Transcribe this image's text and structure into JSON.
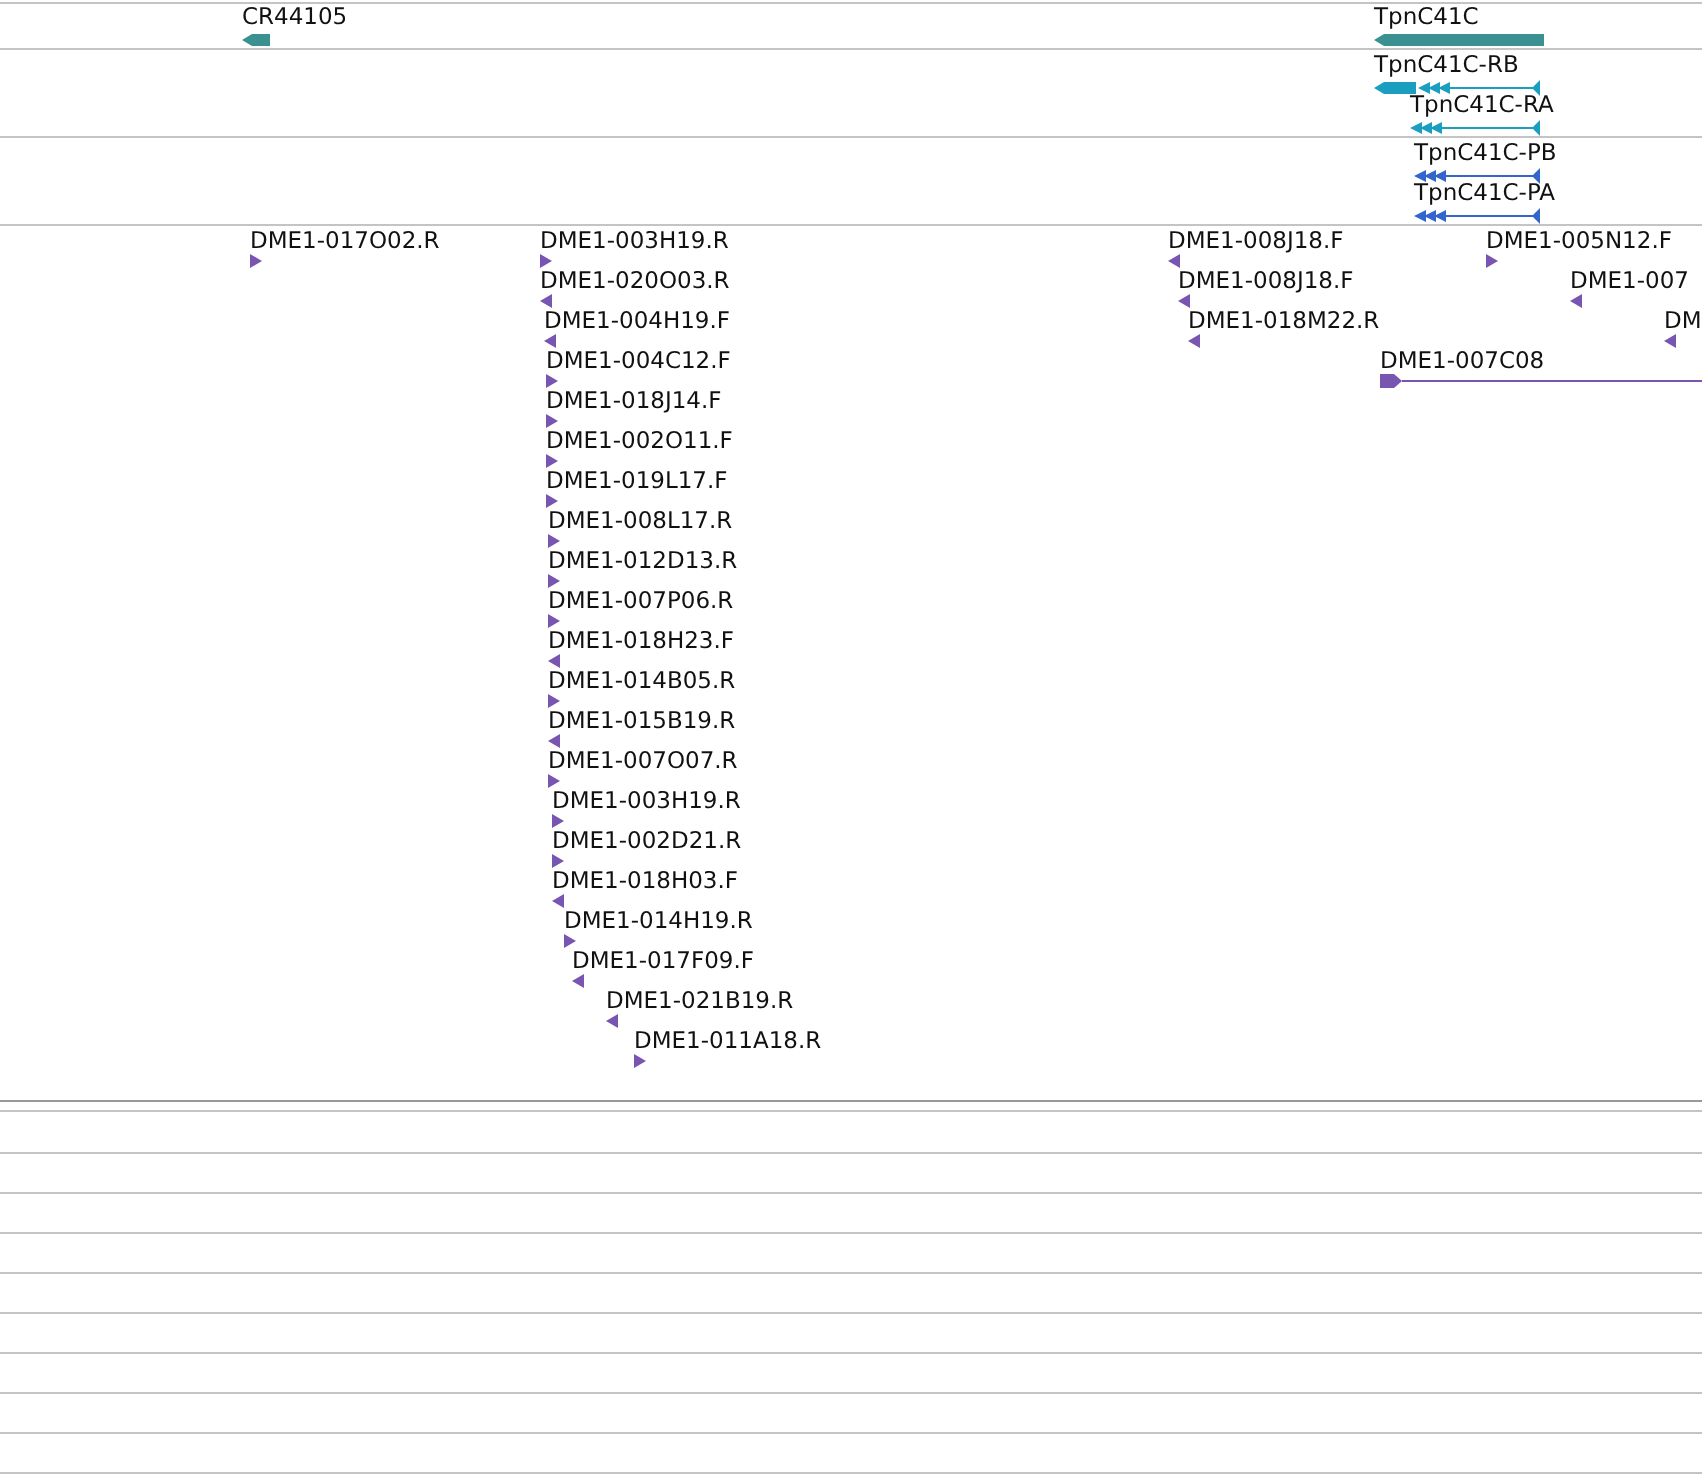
{
  "tracks": [
    {
      "color": "#3b9191",
      "features": [
        {
          "label": "CR44105",
          "kind": "gene",
          "reverse": true
        },
        {
          "label": "TpnC41C",
          "kind": "gene",
          "reverse": true
        }
      ]
    },
    {
      "color": "#1a9fc0",
      "features": [
        {
          "label": "TpnC41C-RB",
          "kind": "transcript",
          "reverse": true
        },
        {
          "label": "TpnC41C-RA",
          "kind": "transcript",
          "reverse": true
        }
      ]
    },
    {
      "color": "#3366cc",
      "features": [
        {
          "label": "TpnC41C-PB",
          "kind": "transcript",
          "reverse": true
        },
        {
          "label": "TpnC41C-PA",
          "kind": "transcript",
          "reverse": true
        }
      ]
    },
    {
      "color": "#7755b0",
      "features": [
        {
          "label": "DME1-017O02.R",
          "kind": "est",
          "reverse": false
        },
        {
          "label": "DME1-003H19.R",
          "kind": "est",
          "reverse": false
        },
        {
          "label": "DME1-020O03.R",
          "kind": "est",
          "reverse": true
        },
        {
          "label": "DME1-004H19.F",
          "kind": "est",
          "reverse": true
        },
        {
          "label": "DME1-004C12.F",
          "kind": "est",
          "reverse": false
        },
        {
          "label": "DME1-018J14.F",
          "kind": "est",
          "reverse": false
        },
        {
          "label": "DME1-002O11.F",
          "kind": "est",
          "reverse": false
        },
        {
          "label": "DME1-019L17.F",
          "kind": "est",
          "reverse": false
        },
        {
          "label": "DME1-008L17.R",
          "kind": "est",
          "reverse": false
        },
        {
          "label": "DME1-012D13.R",
          "kind": "est",
          "reverse": false
        },
        {
          "label": "DME1-007P06.R",
          "kind": "est",
          "reverse": false
        },
        {
          "label": "DME1-018H23.F",
          "kind": "est",
          "reverse": true
        },
        {
          "label": "DME1-014B05.R",
          "kind": "est",
          "reverse": false
        },
        {
          "label": "DME1-015B19.R",
          "kind": "est",
          "reverse": true
        },
        {
          "label": "DME1-007O07.R",
          "kind": "est",
          "reverse": false
        },
        {
          "label": "DME1-003H19.R",
          "kind": "est",
          "reverse": false
        },
        {
          "label": "DME1-002D21.R",
          "kind": "est",
          "reverse": false
        },
        {
          "label": "DME1-018H03.F",
          "kind": "est",
          "reverse": true
        },
        {
          "label": "DME1-014H19.R",
          "kind": "est",
          "reverse": false
        },
        {
          "label": "DME1-017F09.F",
          "kind": "est",
          "reverse": true
        },
        {
          "label": "DME1-021B19.R",
          "kind": "est",
          "reverse": true
        },
        {
          "label": "DME1-011A18.R",
          "kind": "est",
          "reverse": false
        },
        {
          "label": "DME1-008J18.F",
          "kind": "est",
          "reverse": true
        },
        {
          "label": "DME1-008J18.F",
          "kind": "est",
          "reverse": true
        },
        {
          "label": "DME1-018M22.R",
          "kind": "est",
          "reverse": true
        },
        {
          "label": "DME1-005N12.F",
          "kind": "est",
          "reverse": false
        },
        {
          "label": "DME1-007",
          "kind": "est",
          "reverse": true
        },
        {
          "label": "DM",
          "kind": "est",
          "reverse": true
        },
        {
          "label": "DME1-007C08",
          "kind": "alignment",
          "reverse": false
        }
      ]
    }
  ]
}
